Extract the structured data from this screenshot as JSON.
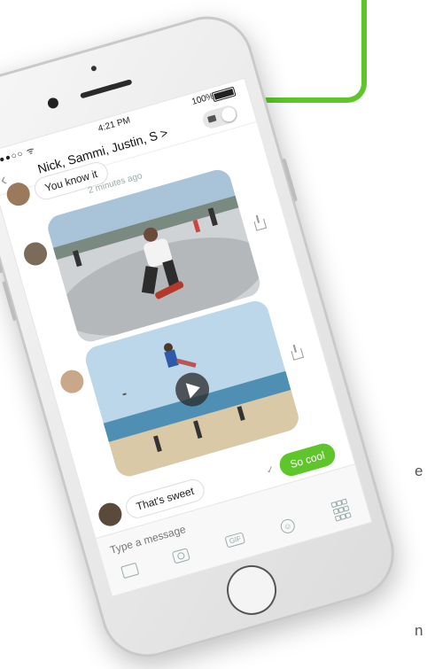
{
  "status_bar": {
    "carrier": "●●●○○ ᯤ",
    "time": "4:21 PM",
    "battery": "100%"
  },
  "nav": {
    "title": "Nick, Sammi, Justin, S >"
  },
  "messages": {
    "prev_text": "You know it",
    "timestamp": "2 minutes ago",
    "reply_in": "That's sweet",
    "reply_out": "So cool"
  },
  "composer": {
    "placeholder": "Type a message",
    "gif_label": "GIF"
  },
  "page_text": {
    "cut_1": "e",
    "cut_2": "n"
  },
  "colors": {
    "accent": "#5ec62a"
  }
}
